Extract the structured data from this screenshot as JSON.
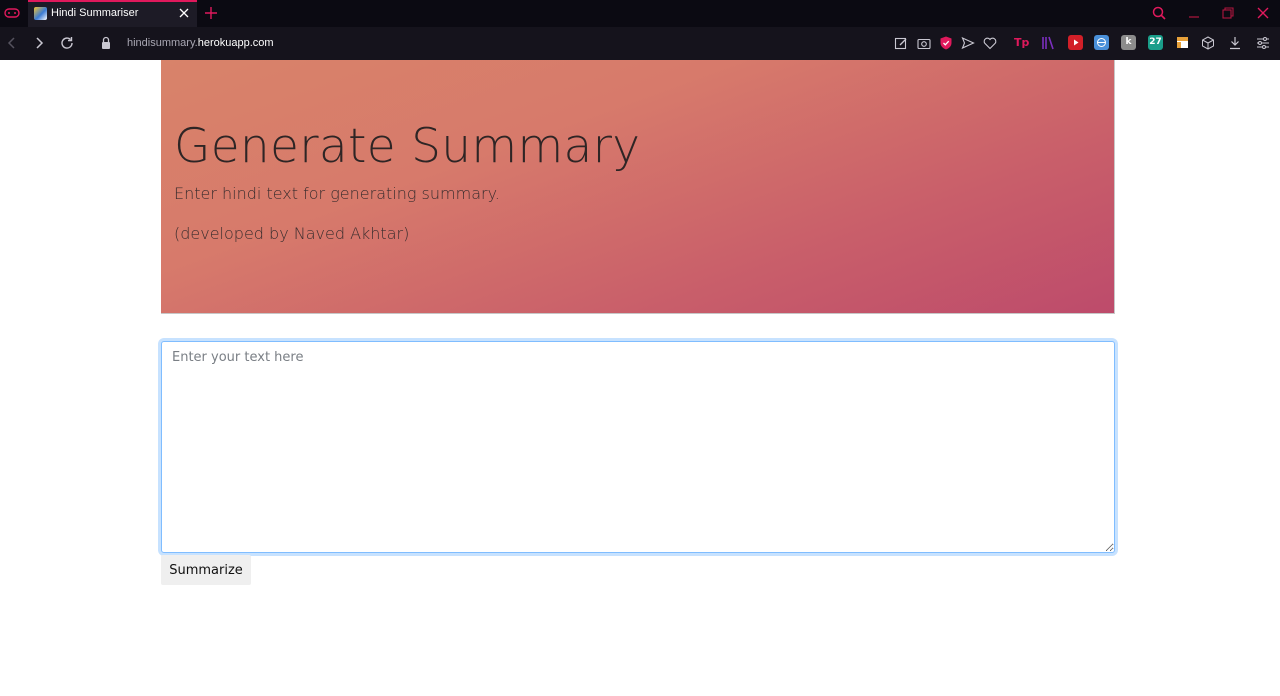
{
  "browser": {
    "tab": {
      "title": "Hindi Summariser"
    },
    "address": {
      "subdomain": "hindisummary.",
      "host": "herokuapp.com"
    },
    "extensions": [
      {
        "name": "tp-extension-icon",
        "label": "Tp",
        "color": "#e0195c"
      },
      {
        "name": "library-extension-icon",
        "label": "",
        "color": "#7b2fbf"
      },
      {
        "name": "video-extension-icon",
        "label": "",
        "color": "#d21f28"
      },
      {
        "name": "translate-extension-icon",
        "label": "",
        "color": "#4a90d9"
      },
      {
        "name": "k-extension-icon",
        "label": "k",
        "color": "#8c8c8c"
      },
      {
        "name": "27-extension-icon",
        "label": "27",
        "color": "#1a9e8a"
      },
      {
        "name": "layout-extension-icon",
        "label": "",
        "color": "#e8a13a"
      }
    ],
    "accent_color": "#e0195c"
  },
  "hero": {
    "title": "Generate Summary",
    "subtitle": "Enter hindi text for generating summary.",
    "credit": "(developed by Naved Akhtar)"
  },
  "form": {
    "placeholder": "Enter your text here",
    "button_label": "Summarize"
  }
}
